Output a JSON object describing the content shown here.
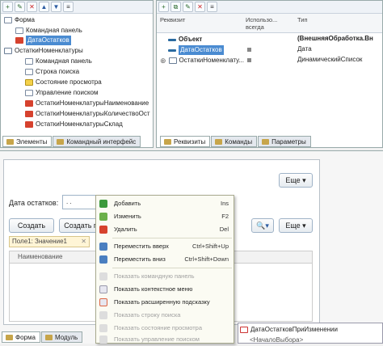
{
  "elements_tree": {
    "items": [
      {
        "label": "Форма",
        "icon": "form-icon"
      },
      {
        "label": "Командная панель",
        "icon": "command-panel-icon"
      },
      {
        "label": "ДатаОстатков",
        "icon": "field-icon",
        "selected": true
      },
      {
        "label": "ОстаткиНоменклатуры",
        "icon": "table-icon"
      },
      {
        "label": "Командная панель",
        "icon": "command-panel-icon"
      },
      {
        "label": "Строка поиска",
        "icon": "search-string-icon"
      },
      {
        "label": "Состояние просмотра",
        "icon": "view-state-icon"
      },
      {
        "label": "Управление поиском",
        "icon": "search-control-icon"
      },
      {
        "label": "ОстаткиНоменклатурыНаименование",
        "icon": "field-icon"
      },
      {
        "label": "ОстаткиНоменклатурыКоличествоОст",
        "icon": "field-icon"
      },
      {
        "label": "ОстаткиНоменклатурыСклад",
        "icon": "field-icon"
      }
    ],
    "tabs": [
      "Элементы",
      "Командный интерфейс"
    ]
  },
  "requisites": {
    "headers": [
      "Реквизит",
      "Использо... всегда",
      "Тип"
    ],
    "rows": [
      {
        "name": "Объект",
        "type": "(ВнешняяОбработка.Вн"
      },
      {
        "name": "ДатаОстатков",
        "type": "Дата"
      },
      {
        "name": "ОстаткиНоменклату...",
        "type": "ДинамическийСписок"
      }
    ],
    "tabs": [
      "Реквизиты",
      "Команды",
      "Параметры"
    ]
  },
  "form": {
    "more_label": "Еще",
    "date_label": "Дата остатков:",
    "date_value": ". .",
    "create_label": "Создать",
    "create2_label": "Создать п",
    "filter_text": "Поле1: Значение1",
    "column_header": "Наименование",
    "tabs": [
      "Форма",
      "Модуль"
    ]
  },
  "context_menu": {
    "items": [
      {
        "label": "Добавить",
        "key": "Ins",
        "enabled": true
      },
      {
        "label": "Изменить",
        "key": "F2",
        "enabled": true
      },
      {
        "label": "Удалить",
        "key": "Del",
        "enabled": true
      },
      {
        "label": "Переместить вверх",
        "key": "Ctrl+Shift+Up",
        "enabled": true
      },
      {
        "label": "Переместить вниз",
        "key": "Ctrl+Shift+Down",
        "enabled": true
      },
      {
        "label": "Показать командную панель",
        "key": "",
        "enabled": false
      },
      {
        "label": "Показать контекстное меню",
        "key": "",
        "enabled": true
      },
      {
        "label": "Показать расширенную подсказку",
        "key": "",
        "enabled": true
      },
      {
        "label": "Показать строку поиска",
        "key": "",
        "enabled": false
      },
      {
        "label": "Показать состояние просмотра",
        "key": "",
        "enabled": false
      },
      {
        "label": "Показать управление поиском",
        "key": "",
        "enabled": false
      }
    ]
  },
  "popup": {
    "items": [
      "ДатаОстатковПриИзменении",
      "<НачалоВыбора>"
    ]
  }
}
